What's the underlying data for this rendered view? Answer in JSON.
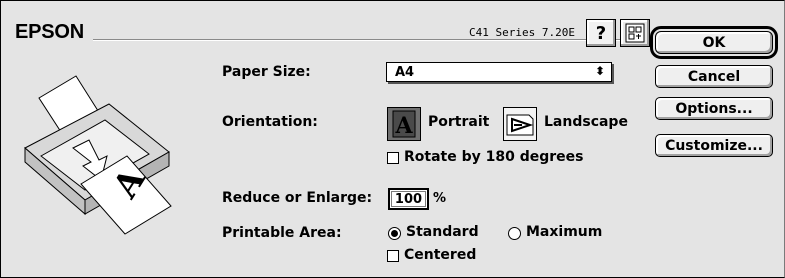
{
  "header": {
    "brand": "EPSON",
    "version": "C41 Series 7.20E",
    "help_icon": "question-icon",
    "help_glyph": "?",
    "info_icon": "config-icon"
  },
  "paper_size": {
    "label": "Paper Size:",
    "value": "A4",
    "arrows": "⬍"
  },
  "orientation": {
    "label": "Orientation:",
    "portrait": "Portrait",
    "landscape": "Landscape",
    "portrait_glyph": "A",
    "selected": "Portrait",
    "rotate_label": "Rotate by 180 degrees",
    "rotate_checked": false
  },
  "reduce": {
    "label": "Reduce or Enlarge:",
    "value": "100",
    "unit": "%"
  },
  "printable_area": {
    "label": "Printable Area:",
    "standard": "Standard",
    "maximum": "Maximum",
    "selected": "Standard",
    "centered_label": "Centered",
    "centered_checked": false
  },
  "buttons": {
    "ok": "OK",
    "cancel": "Cancel",
    "options": "Options...",
    "customize": "Customize..."
  },
  "preview": {
    "paper_glyph": "A"
  }
}
